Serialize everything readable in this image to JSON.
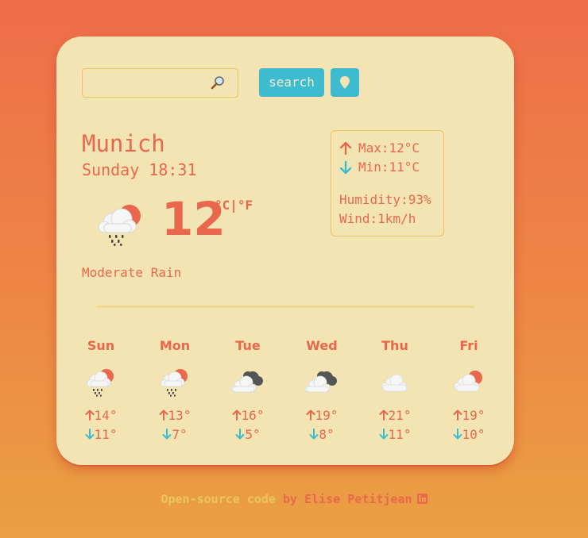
{
  "search": {
    "placeholder": "",
    "button_label": "search"
  },
  "current": {
    "city": "Munich",
    "datetime": "Sunday 18:31",
    "temperature": "12",
    "units": "°C|°F",
    "description": "Moderate Rain",
    "icon": "rain-sun-icon"
  },
  "stats": {
    "max": "Max:12°C",
    "min": "Min:11°C",
    "humidity": "Humidity:93%",
    "wind": "Wind:1km/h"
  },
  "forecast": [
    {
      "day": "Sun",
      "icon": "rain-sun-icon",
      "high": "14°",
      "low": "11°"
    },
    {
      "day": "Mon",
      "icon": "rain-sun-icon",
      "high": "13°",
      "low": "7°"
    },
    {
      "day": "Tue",
      "icon": "dark-clouds-icon",
      "high": "16°",
      "low": "5°"
    },
    {
      "day": "Wed",
      "icon": "dark-clouds-icon",
      "high": "19°",
      "low": "8°"
    },
    {
      "day": "Thu",
      "icon": "cloud-icon",
      "high": "21°",
      "low": "11°"
    },
    {
      "day": "Fri",
      "icon": "cloud-sun-icon",
      "high": "19°",
      "low": "10°"
    }
  ],
  "footer": {
    "link_text": "Open-source code",
    "by_text": " by Elise Petitjean",
    "icon": "linkedin-icon"
  },
  "colors": {
    "accent": "#e9684d",
    "card": "#f2e4b3",
    "button": "#3ebbcf",
    "border": "#eac562"
  }
}
